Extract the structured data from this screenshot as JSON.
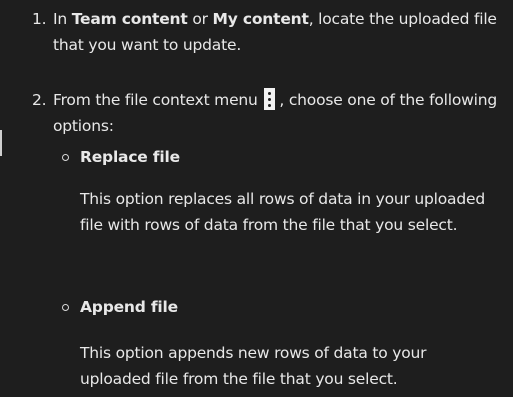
{
  "step1": {
    "number": "1.",
    "text_a": "In ",
    "strong_a": "Team content",
    "text_b": " or ",
    "strong_b": "My content",
    "text_c": ", locate the uploaded file that you want to update."
  },
  "step2": {
    "number": "2.",
    "text_a": "From the file context menu",
    "menu_icon": "overflow-menu-vertical-icon",
    "text_b": ", choose one of the following options:"
  },
  "options": [
    {
      "title": "Replace file",
      "description": "This option replaces all rows of data in your uploaded file with rows of data from the file that you select."
    },
    {
      "title": "Append file",
      "description": "This option appends new rows of data to your uploaded file from the file that you select."
    }
  ],
  "colors": {
    "background": "#1e1e1e",
    "text": "#e8e8e8"
  }
}
